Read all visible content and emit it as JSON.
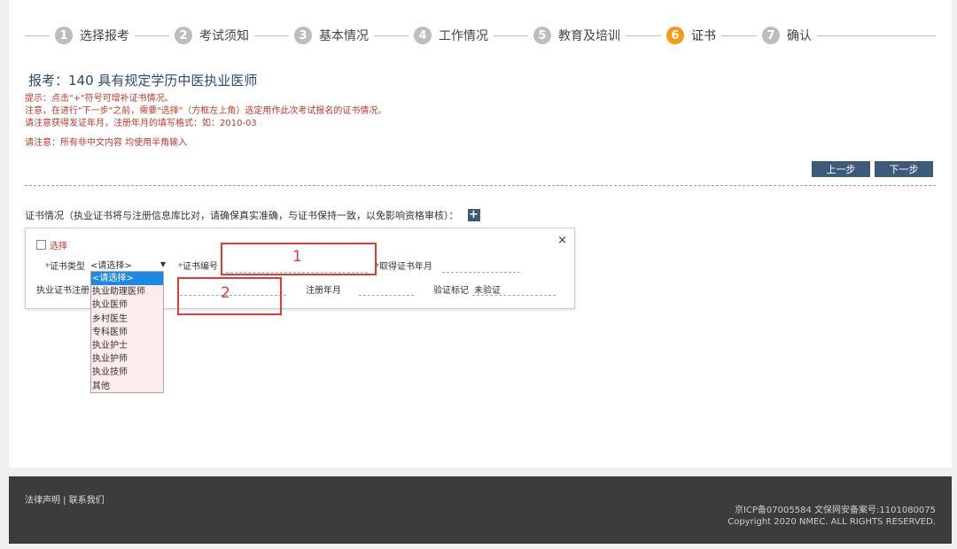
{
  "steps": [
    {
      "num": "1",
      "label": "选择报考"
    },
    {
      "num": "2",
      "label": "考试须知"
    },
    {
      "num": "3",
      "label": "基本情况"
    },
    {
      "num": "4",
      "label": "工作情况"
    },
    {
      "num": "5",
      "label": "教育及培训"
    },
    {
      "num": "6",
      "label": "证书"
    },
    {
      "num": "7",
      "label": "确认"
    }
  ],
  "active_step": "6",
  "title": "报考：140 具有规定学历中医执业医师",
  "notes": [
    "提示：点击\"+\"符号可增补证书情况。",
    "注意，在进行\"下一步\"之前，需要\"选择\"（方框左上角）选定用作此次考试报名的证书情况。",
    "请注意获得发证年月，注册年月的填写格式：如：2010-03",
    "请注意：所有非中文内容 均使用半角输入"
  ],
  "buttons": {
    "prev": "上一步",
    "next": "下一步"
  },
  "cert_section": {
    "heading": "证书情况（执业证书将与注册信息库比对，请确保真实准确，与证书保持一致，以免影响资格审核）：",
    "add_symbol": "+",
    "close_symbol": "×",
    "select_label": "选择",
    "required_mark": "*",
    "cert_type_label": "证书类型",
    "cert_type_value": "<请选择>",
    "cert_no_label": "证书编号",
    "obtain_date_label": "取得证书年月",
    "reg_unit_label": "执业证书注册",
    "reg_date_label": "注册年月",
    "verify_label": "验证标记",
    "verify_value": "未验证"
  },
  "dropdown_options": [
    "<请选择>",
    "执业助理医师",
    "执业医师",
    "乡村医生",
    "专科医师",
    "执业护士",
    "执业护师",
    "执业技师",
    "其他"
  ],
  "dropdown_selected_index": 0,
  "annotations": {
    "box1": "1",
    "box2": "2"
  },
  "footer": {
    "links": "法律声明 | 联系我们",
    "icp": "京ICP备07005584 文保网安备案号:1101080075",
    "copyright": "Copyright 2020 NMEC. ALL RIGHTS RESERVED."
  },
  "colors": {
    "accent_active": "#f59b12",
    "button": "#3d5a78",
    "alert_text": "#c0392b",
    "annotation": "#e53935"
  }
}
